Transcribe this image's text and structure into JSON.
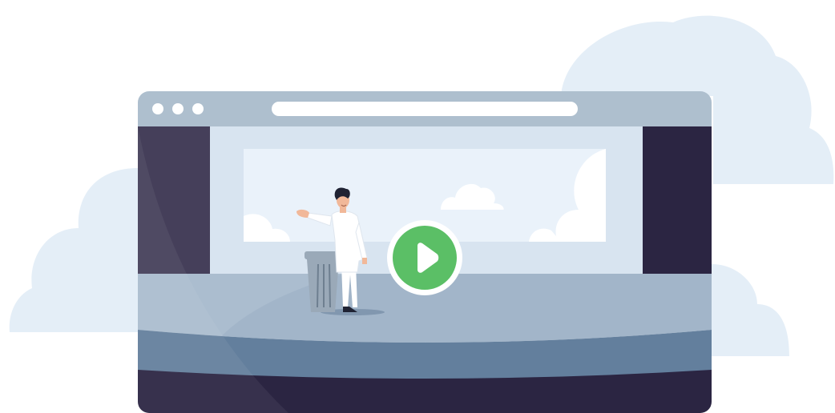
{
  "colors": {
    "background": "#ffffff",
    "cloud_back": "#e4eef7",
    "window_chrome": "#aebfce",
    "window_dot": "#ffffff",
    "address_bar": "#ffffff",
    "curtain_left": "#453f5a",
    "curtain_right": "#2b2542",
    "stage_backwall": "#d8e4f0",
    "stage_screen": "#eaf2fa",
    "stage_floor": "#a2b5c9",
    "stage_edge": "#637f9d",
    "stage_front": "#2b2542",
    "play_ring": "#ffffff",
    "play_fill": "#5bbf66",
    "podium": "#9aa9b8",
    "presenter_coat": "#ffffff",
    "presenter_hair": "#1f2233"
  },
  "icons": {
    "window_controls": [
      "window-dot-icon",
      "window-dot-icon",
      "window-dot-icon"
    ],
    "play": "play-icon",
    "presenter": "presenter-illustration",
    "podium": "podium-illustration"
  }
}
